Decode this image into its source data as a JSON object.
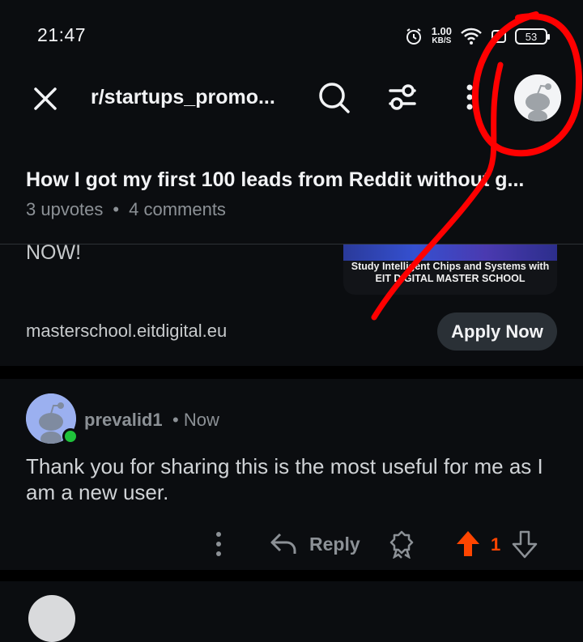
{
  "status": {
    "time": "21:47",
    "speed_value": "1.00",
    "speed_unit": "KB/S",
    "battery": "53"
  },
  "header": {
    "subreddit": "r/startups_promo..."
  },
  "post": {
    "title": "How I got my first 100 leads from Reddit without g...",
    "upvotes": "3 upvotes",
    "comments": "4 comments",
    "dot": "•"
  },
  "ad": {
    "partial_text": "NOW!",
    "image_caption_line1": "Study Intelligent Chips and Systems with",
    "image_caption_line2": "EIT DIGITAL MASTER SCHOOL",
    "domain": "masterschool.eitdigital.eu",
    "cta": "Apply Now"
  },
  "comment": {
    "username": "prevalid1",
    "time": "• Now",
    "body": "Thank you for sharing this is the most useful for me as I am a new user.",
    "reply_label": "Reply",
    "votes": "1"
  },
  "colors": {
    "accent_vote": "#ff4500",
    "annotation": "#ff0000",
    "online": "#1fc23b"
  },
  "icons": [
    "close-icon",
    "search-icon",
    "filter-icon",
    "more-icon",
    "avatar",
    "reply-icon",
    "award-icon",
    "upvote-icon",
    "downvote-icon"
  ]
}
